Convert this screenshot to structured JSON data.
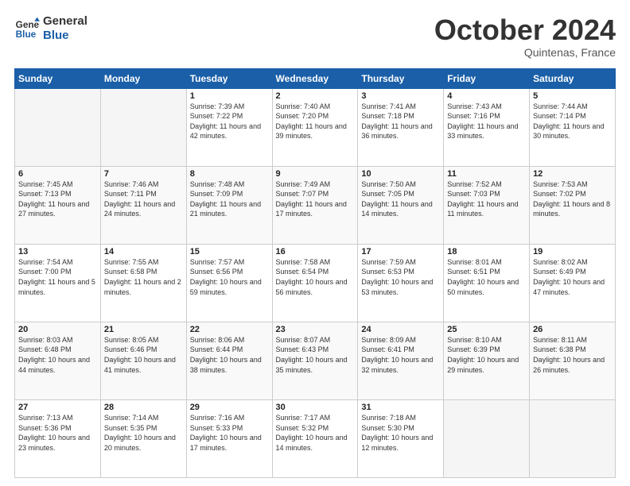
{
  "logo": {
    "line1": "General",
    "line2": "Blue"
  },
  "header": {
    "month": "October 2024",
    "location": "Quintenas, France"
  },
  "weekdays": [
    "Sunday",
    "Monday",
    "Tuesday",
    "Wednesday",
    "Thursday",
    "Friday",
    "Saturday"
  ],
  "weeks": [
    [
      {
        "day": "",
        "info": ""
      },
      {
        "day": "",
        "info": ""
      },
      {
        "day": "1",
        "info": "Sunrise: 7:39 AM\nSunset: 7:22 PM\nDaylight: 11 hours and 42 minutes."
      },
      {
        "day": "2",
        "info": "Sunrise: 7:40 AM\nSunset: 7:20 PM\nDaylight: 11 hours and 39 minutes."
      },
      {
        "day": "3",
        "info": "Sunrise: 7:41 AM\nSunset: 7:18 PM\nDaylight: 11 hours and 36 minutes."
      },
      {
        "day": "4",
        "info": "Sunrise: 7:43 AM\nSunset: 7:16 PM\nDaylight: 11 hours and 33 minutes."
      },
      {
        "day": "5",
        "info": "Sunrise: 7:44 AM\nSunset: 7:14 PM\nDaylight: 11 hours and 30 minutes."
      }
    ],
    [
      {
        "day": "6",
        "info": "Sunrise: 7:45 AM\nSunset: 7:13 PM\nDaylight: 11 hours and 27 minutes."
      },
      {
        "day": "7",
        "info": "Sunrise: 7:46 AM\nSunset: 7:11 PM\nDaylight: 11 hours and 24 minutes."
      },
      {
        "day": "8",
        "info": "Sunrise: 7:48 AM\nSunset: 7:09 PM\nDaylight: 11 hours and 21 minutes."
      },
      {
        "day": "9",
        "info": "Sunrise: 7:49 AM\nSunset: 7:07 PM\nDaylight: 11 hours and 17 minutes."
      },
      {
        "day": "10",
        "info": "Sunrise: 7:50 AM\nSunset: 7:05 PM\nDaylight: 11 hours and 14 minutes."
      },
      {
        "day": "11",
        "info": "Sunrise: 7:52 AM\nSunset: 7:03 PM\nDaylight: 11 hours and 11 minutes."
      },
      {
        "day": "12",
        "info": "Sunrise: 7:53 AM\nSunset: 7:02 PM\nDaylight: 11 hours and 8 minutes."
      }
    ],
    [
      {
        "day": "13",
        "info": "Sunrise: 7:54 AM\nSunset: 7:00 PM\nDaylight: 11 hours and 5 minutes."
      },
      {
        "day": "14",
        "info": "Sunrise: 7:55 AM\nSunset: 6:58 PM\nDaylight: 11 hours and 2 minutes."
      },
      {
        "day": "15",
        "info": "Sunrise: 7:57 AM\nSunset: 6:56 PM\nDaylight: 10 hours and 59 minutes."
      },
      {
        "day": "16",
        "info": "Sunrise: 7:58 AM\nSunset: 6:54 PM\nDaylight: 10 hours and 56 minutes."
      },
      {
        "day": "17",
        "info": "Sunrise: 7:59 AM\nSunset: 6:53 PM\nDaylight: 10 hours and 53 minutes."
      },
      {
        "day": "18",
        "info": "Sunrise: 8:01 AM\nSunset: 6:51 PM\nDaylight: 10 hours and 50 minutes."
      },
      {
        "day": "19",
        "info": "Sunrise: 8:02 AM\nSunset: 6:49 PM\nDaylight: 10 hours and 47 minutes."
      }
    ],
    [
      {
        "day": "20",
        "info": "Sunrise: 8:03 AM\nSunset: 6:48 PM\nDaylight: 10 hours and 44 minutes."
      },
      {
        "day": "21",
        "info": "Sunrise: 8:05 AM\nSunset: 6:46 PM\nDaylight: 10 hours and 41 minutes."
      },
      {
        "day": "22",
        "info": "Sunrise: 8:06 AM\nSunset: 6:44 PM\nDaylight: 10 hours and 38 minutes."
      },
      {
        "day": "23",
        "info": "Sunrise: 8:07 AM\nSunset: 6:43 PM\nDaylight: 10 hours and 35 minutes."
      },
      {
        "day": "24",
        "info": "Sunrise: 8:09 AM\nSunset: 6:41 PM\nDaylight: 10 hours and 32 minutes."
      },
      {
        "day": "25",
        "info": "Sunrise: 8:10 AM\nSunset: 6:39 PM\nDaylight: 10 hours and 29 minutes."
      },
      {
        "day": "26",
        "info": "Sunrise: 8:11 AM\nSunset: 6:38 PM\nDaylight: 10 hours and 26 minutes."
      }
    ],
    [
      {
        "day": "27",
        "info": "Sunrise: 7:13 AM\nSunset: 5:36 PM\nDaylight: 10 hours and 23 minutes."
      },
      {
        "day": "28",
        "info": "Sunrise: 7:14 AM\nSunset: 5:35 PM\nDaylight: 10 hours and 20 minutes."
      },
      {
        "day": "29",
        "info": "Sunrise: 7:16 AM\nSunset: 5:33 PM\nDaylight: 10 hours and 17 minutes."
      },
      {
        "day": "30",
        "info": "Sunrise: 7:17 AM\nSunset: 5:32 PM\nDaylight: 10 hours and 14 minutes."
      },
      {
        "day": "31",
        "info": "Sunrise: 7:18 AM\nSunset: 5:30 PM\nDaylight: 10 hours and 12 minutes."
      },
      {
        "day": "",
        "info": ""
      },
      {
        "day": "",
        "info": ""
      }
    ]
  ]
}
